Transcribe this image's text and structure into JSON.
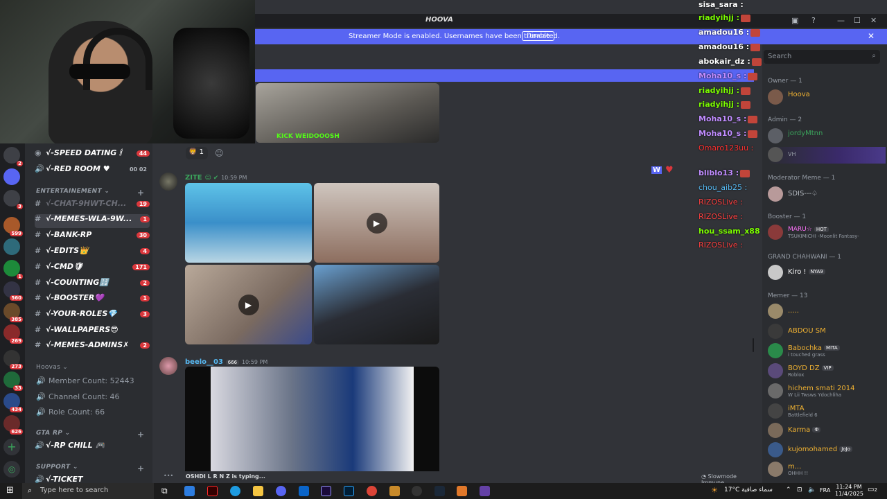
{
  "window": {
    "title": "HOOVA"
  },
  "streamer_banner": {
    "message": "Streamer Mode is enabled. Usernames have been truncated.",
    "button": "Disable"
  },
  "rail_badges": [
    "2",
    "3",
    "599",
    "1",
    "560",
    "385",
    "269",
    "273",
    "33",
    "434",
    "626"
  ],
  "channels": {
    "top": [
      {
        "name": "√-SPEED DATING 🕯",
        "badge": "44"
      },
      {
        "name": "√-RED ROOM ♥",
        "badge": "00 02"
      }
    ],
    "entertainment_label": "ENTERTAINEMENT",
    "ent": [
      {
        "name": "√-CHAT-9HWT-CH...",
        "badge": "19"
      },
      {
        "name": "√-MEMES-WLA-9W...",
        "badge": "1"
      },
      {
        "name": "√-BANK-RP",
        "badge": "30"
      },
      {
        "name": "√-EDITS👑",
        "badge": "4"
      },
      {
        "name": "√-CMD🛡",
        "badge": "171"
      },
      {
        "name": "√-COUNTING🔢",
        "badge": "2"
      },
      {
        "name": "√-BOOSTER💜",
        "badge": "1"
      },
      {
        "name": "√-YOUR-ROLES💎",
        "badge": "3"
      },
      {
        "name": "√-WALLPAPERS😎",
        "badge": ""
      },
      {
        "name": "√-MEMES-ADMINS✗",
        "badge": "2"
      }
    ],
    "hoovas_label": "Hoovas",
    "stats": [
      "Member Count: 52443",
      "Channel Count: 46",
      "Role Count: 66"
    ],
    "gta_label": "GTA RP",
    "gta_channel": "√-RP CHILL 🎮",
    "support_label": "SUPPORT",
    "ticket": "√-TICKET"
  },
  "messages": [
    {
      "author": "ZITE",
      "time": "10:59 PM",
      "author_color": "#3ba55c"
    },
    {
      "author": "beelo__03",
      "badge": "666",
      "time": "10:59 PM",
      "author_color": "#57b9f2"
    }
  ],
  "reaction": {
    "count": "1"
  },
  "embed_watermark": "KICK WEIDOOOSH",
  "twitch_chat": [
    {
      "name": "sisa_sara :",
      "color": "#ffffff"
    },
    {
      "name": "riadyihjj :",
      "color": "#7cfc00"
    },
    {
      "name": "amadou16 :",
      "color": "#ffffff"
    },
    {
      "name": "amadou16 :",
      "color": "#ffffff"
    },
    {
      "name": "abokair_dz :",
      "color": "#ffffff"
    },
    {
      "name": "Moha10_s :",
      "color": "#c08cff"
    },
    {
      "name": "riadyihjj :",
      "color": "#7cfc00"
    },
    {
      "name": "riadyihjj :",
      "color": "#7cfc00"
    },
    {
      "name": "Moha10_s :",
      "color": "#c08cff"
    },
    {
      "name": "Moha10_s :",
      "color": "#c08cff"
    },
    {
      "name": "Omaro123uu :",
      "color": "#ff3030"
    },
    {
      "name": "bliblo13 :",
      "color": "#c08cff"
    },
    {
      "name": "chou_aib25 :",
      "color": "#57b9f2"
    },
    {
      "name": "RIZOSLive :",
      "color": "#ff4040"
    },
    {
      "name": "RIZOSLive :",
      "color": "#ff4040"
    },
    {
      "name": "hou_ssam_x88 :",
      "color": "#7cfc00"
    },
    {
      "name": "RIZOSLive :",
      "color": "#ff4040"
    }
  ],
  "members": {
    "search_placeholder": "Search",
    "groups": [
      {
        "header": "Owner — 1",
        "items": [
          {
            "name": "Hoova",
            "color": "#f0b232",
            "sub": ""
          }
        ]
      },
      {
        "header": "Admin — 2",
        "items": [
          {
            "name": "jordyMtnn",
            "color": "#3ba55c",
            "sub": ""
          },
          {
            "name": "VH",
            "color": "#949ba4",
            "sub": ""
          }
        ]
      },
      {
        "header": "Moderator Meme — 1",
        "items": [
          {
            "name": "SDIS---♤",
            "color": "#b5bac1",
            "sub": ""
          }
        ]
      },
      {
        "header": "Booster — 1",
        "items": [
          {
            "name": "MARU☆",
            "tag": "HOT",
            "color": "#ff73fa",
            "sub": "TSUKIMICHI -Moonlit Fantasy-"
          }
        ]
      },
      {
        "header": "GRAND CHAHWANI — 1",
        "items": [
          {
            "name": "Kiro !",
            "tag": "NYA9",
            "color": "#ffffff",
            "sub": ""
          }
        ]
      },
      {
        "header": "Memer — 13",
        "items": [
          {
            "name": ".....",
            "color": "#f0b232",
            "sub": ""
          },
          {
            "name": "ABDOU SM",
            "color": "#f0b232",
            "sub": ""
          },
          {
            "name": "Babochka",
            "tag": "MITA",
            "color": "#f0b232",
            "sub": "i touched grass"
          },
          {
            "name": "BOYD DZ",
            "tag": "VIP",
            "color": "#f0b232",
            "sub": "Roblox"
          },
          {
            "name": "hichem smati 2014",
            "color": "#f0b232",
            "sub": "W Lii Twsws Ydochliha"
          },
          {
            "name": "iMTA",
            "color": "#f0b232",
            "sub": "Battlefield 6"
          },
          {
            "name": "Karma",
            "tag": "Ф",
            "color": "#f0b232",
            "sub": ""
          },
          {
            "name": "kujomohamed",
            "tag": "JoJo",
            "color": "#f0b232",
            "sub": ""
          },
          {
            "name": "m...",
            "color": "#f0b232",
            "sub": "OHHH !!"
          }
        ]
      }
    ]
  },
  "typing": "OSHDI L R N Z is typing...",
  "slowmode": "Slowmode Immune",
  "taskbar": {
    "search": "Type here to search",
    "weather": "17°C سماء صافية",
    "lang": "FRA",
    "time": "11:24 PM",
    "date": "11/4/2025",
    "notif": "2"
  },
  "colors": {
    "blurple": "#5865f2",
    "red": "#da373c",
    "bg": "#313338"
  }
}
